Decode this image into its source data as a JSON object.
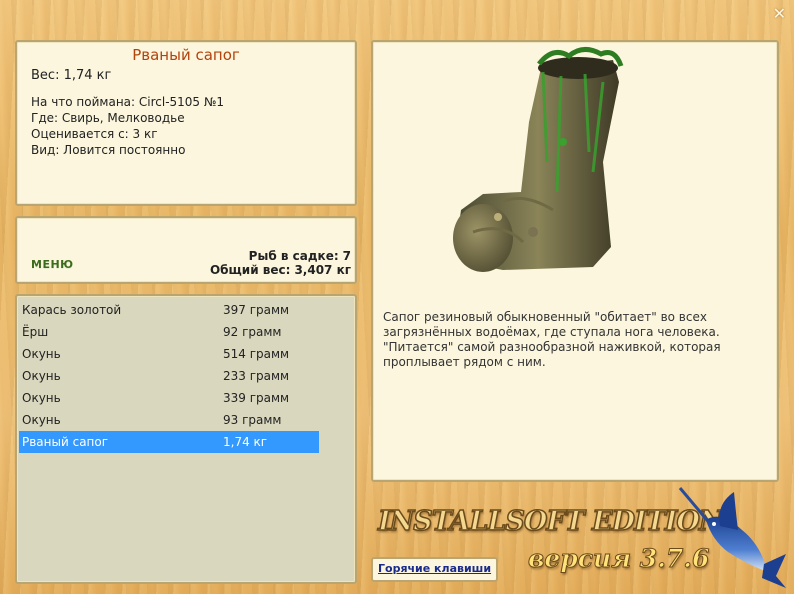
{
  "window": {
    "close_label": "✕"
  },
  "fish_card": {
    "name": "Рваный сапог",
    "weight": "Вес: 1,74 кг",
    "details": [
      "На что поймана: Circl-5105 №1",
      "Где: Свирь, Мелководье",
      "Оценивается с: 3 кг",
      "Вид: Ловится постоянно"
    ]
  },
  "summary": {
    "menu_label": "МЕНЮ",
    "count_label": "Рыб в садке:",
    "count_value": "7",
    "total_label": "Общий вес:",
    "total_value": "3,407 кг"
  },
  "catch_list": [
    {
      "name": "Карась золотой",
      "weight": "397 грамм"
    },
    {
      "name": "Ёрш",
      "weight": "92 грамм"
    },
    {
      "name": "Окунь",
      "weight": "514 грамм"
    },
    {
      "name": "Окунь",
      "weight": "233 грамм"
    },
    {
      "name": "Окунь",
      "weight": "339 грамм"
    },
    {
      "name": "Окунь",
      "weight": "93 грамм"
    },
    {
      "name": "Рваный сапог",
      "weight": "1,74 кг",
      "selected": true
    }
  ],
  "picture": {
    "icon": "rubber-boot-image",
    "description": "Сапог резиновый обыкновенный \"обитает\" во всех загрязнённых водоёмах, где ступала нога человека. \"Питается\" самой разнообразной наживкой, которая проплывает рядом с ним."
  },
  "footer": {
    "brand": "INSTALLSOFT EDITION",
    "version": "версия 3.7.6",
    "hotkeys_label": "Горячие клавиши",
    "logo_icon": "marlin-fish-icon"
  },
  "colors": {
    "selection": "#3399ff",
    "title": "#b4420c",
    "menu": "#3c6b1e"
  }
}
